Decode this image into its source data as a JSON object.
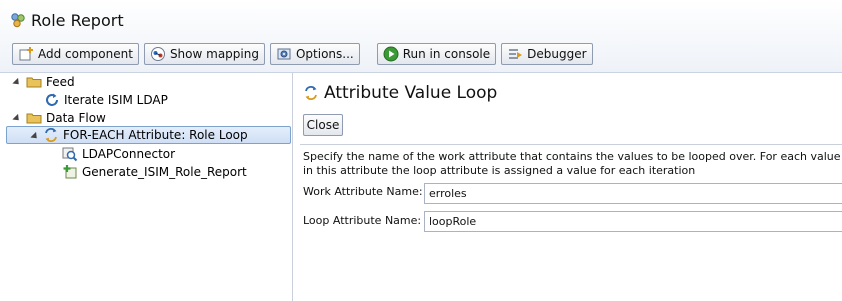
{
  "window": {
    "title": "Role Report",
    "title_icon": "role-report-icon"
  },
  "toolbar": {
    "buttons": [
      {
        "label": "Add component",
        "icon": "add-component-icon"
      },
      {
        "label": "Show mapping",
        "icon": "mapping-icon"
      },
      {
        "label": "Options...",
        "icon": "options-icon"
      },
      {
        "label": "Run in console",
        "icon": "run-icon"
      },
      {
        "label": "Debugger",
        "icon": "debugger-icon"
      }
    ]
  },
  "tree": {
    "feed": {
      "label": "Feed",
      "icon": "folder-icon"
    },
    "feed_child": {
      "label": "Iterate ISIM LDAP",
      "icon": "iterator-icon"
    },
    "dataflow": {
      "label": "Data Flow",
      "icon": "folder-icon"
    },
    "loop": {
      "label": "FOR-EACH Attribute: Role Loop",
      "icon": "loop-icon"
    },
    "loop_children": [
      {
        "label": "LDAPConnector",
        "icon": "lookup-icon"
      },
      {
        "label": "Generate_ISIM_Role_Report",
        "icon": "add-output-icon"
      }
    ]
  },
  "detail": {
    "title": "Attribute Value Loop",
    "close_label": "Close",
    "description": "Specify the name of the work attribute that contains the values to be looped over. For each value in this attribute the loop attribute is assigned a value for each iteration",
    "fields": {
      "work_attribute_label": "Work Attribute Name:",
      "work_attribute_value": "erroles",
      "loop_attribute_label": "Loop Attribute Name:",
      "loop_attribute_value": "loopRole"
    }
  },
  "colors": {
    "header_bg": "#eef2f8",
    "selection_bg": "#cfdff5",
    "selection_border": "#7da2ce",
    "run_green": "#3a9a35",
    "folder_yellow": "#e9c25a"
  }
}
